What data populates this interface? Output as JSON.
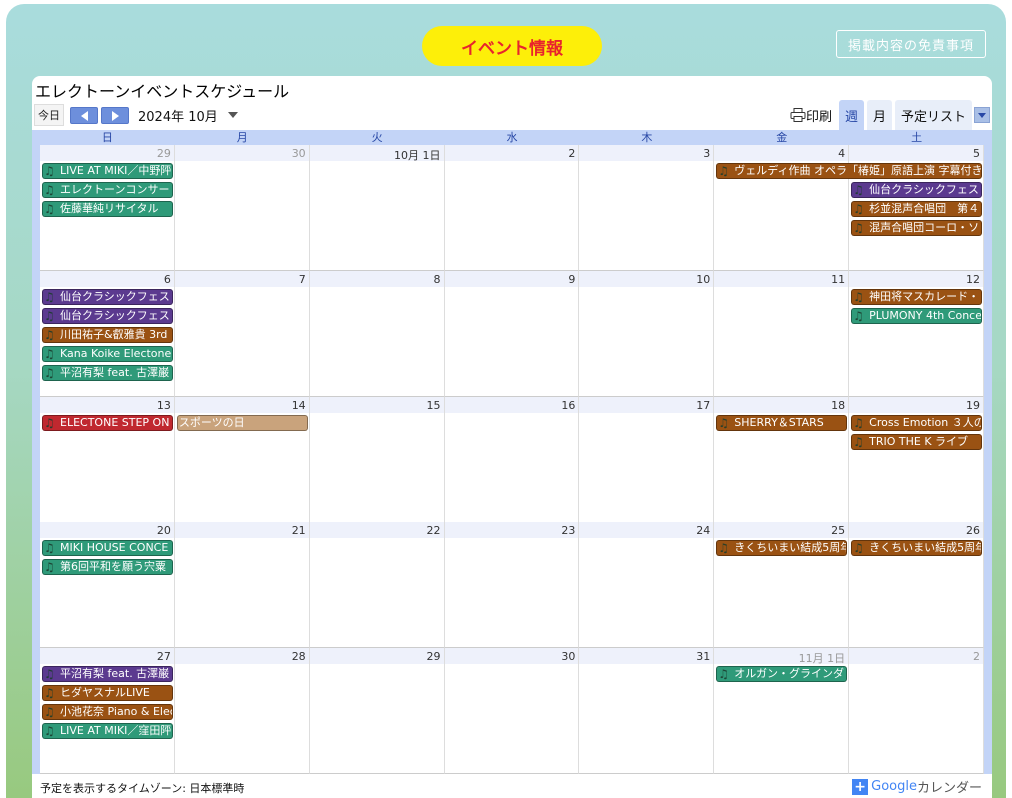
{
  "header": {
    "title": "イベント情報",
    "disclaimer_label": "掲載内容の免責事項"
  },
  "calendar": {
    "title": "エレクトーンイベントスケジュール",
    "today_label": "今日",
    "month_label": "2024年 10月",
    "print_label": "印刷",
    "tabs": [
      "週",
      "月",
      "予定リスト"
    ],
    "active_tab": "週",
    "weekdays": [
      "日",
      "月",
      "火",
      "水",
      "木",
      "金",
      "土"
    ],
    "weeks": [
      {
        "days": [
          "29",
          "30",
          "10月 1日",
          "2",
          "3",
          "4",
          "5"
        ],
        "other": [
          true,
          true,
          false,
          false,
          false,
          false,
          false
        ]
      },
      {
        "days": [
          "6",
          "7",
          "8",
          "9",
          "10",
          "11",
          "12"
        ],
        "other": [
          false,
          false,
          false,
          false,
          false,
          false,
          false
        ]
      },
      {
        "days": [
          "13",
          "14",
          "15",
          "16",
          "17",
          "18",
          "19"
        ],
        "other": [
          false,
          false,
          false,
          false,
          false,
          false,
          false
        ]
      },
      {
        "days": [
          "20",
          "21",
          "22",
          "23",
          "24",
          "25",
          "26"
        ],
        "other": [
          false,
          false,
          false,
          false,
          false,
          false,
          false
        ]
      },
      {
        "days": [
          "27",
          "28",
          "29",
          "30",
          "31",
          "11月 1日",
          "2"
        ],
        "other": [
          false,
          false,
          false,
          false,
          false,
          true,
          true
        ]
      }
    ],
    "events": [
      {
        "week": 0,
        "col": 0,
        "slot": 0,
        "text": "LIVE AT MIKI／中野𨸶",
        "color": "#2f9a79",
        "note": true
      },
      {
        "week": 0,
        "col": 0,
        "slot": 1,
        "text": "エレクトーンコンサー",
        "color": "#2f9a79",
        "note": true
      },
      {
        "week": 0,
        "col": 0,
        "slot": 2,
        "text": "佐藤華純リサイタル",
        "color": "#2f9a79",
        "note": true
      },
      {
        "week": 0,
        "col": 5,
        "slot": 0,
        "span": 2,
        "text": "ヴェルディ作曲 オペラ「椿姫」原語上演 字幕付き",
        "color": "#9a5213",
        "note": true
      },
      {
        "week": 0,
        "col": 6,
        "slot": 1,
        "text": "仙台クラシックフェス",
        "color": "#5b3a8f",
        "note": true
      },
      {
        "week": 0,
        "col": 6,
        "slot": 2,
        "text": "杉並混声合唱団　第４",
        "color": "#9a5213",
        "note": true
      },
      {
        "week": 0,
        "col": 6,
        "slot": 3,
        "text": "混声合唱団コーロ・ソ",
        "color": "#9a5213",
        "note": true
      },
      {
        "week": 1,
        "col": 0,
        "slot": 0,
        "text": "仙台クラシックフェス",
        "color": "#5b3a8f",
        "note": true
      },
      {
        "week": 1,
        "col": 0,
        "slot": 1,
        "text": "仙台クラシックフェス",
        "color": "#5b3a8f",
        "note": true
      },
      {
        "week": 1,
        "col": 0,
        "slot": 2,
        "text": "川田祐子&叡雅貴 3rd",
        "color": "#9a5213",
        "note": true
      },
      {
        "week": 1,
        "col": 0,
        "slot": 3,
        "text": "Kana Koike Electone",
        "color": "#2f9a79",
        "note": true
      },
      {
        "week": 1,
        "col": 0,
        "slot": 4,
        "text": "平沼有梨 feat. 古澤巌",
        "color": "#2f9a79",
        "note": true
      },
      {
        "week": 1,
        "col": 6,
        "slot": 0,
        "text": "神田将マスカレード・",
        "color": "#9a5213",
        "note": true
      },
      {
        "week": 1,
        "col": 6,
        "slot": 1,
        "text": "PLUMONY 4th Conce",
        "color": "#2f9a79",
        "note": true
      },
      {
        "week": 2,
        "col": 0,
        "slot": 0,
        "text": "ELECTONE STEP ON",
        "color": "#c0282f",
        "note": true
      },
      {
        "week": 2,
        "col": 1,
        "slot": 0,
        "text": "スポーツの日",
        "color": "#c9a37c",
        "note": false
      },
      {
        "week": 2,
        "col": 5,
        "slot": 0,
        "text": "SHERRY＆STARS",
        "color": "#9a5213",
        "note": true
      },
      {
        "week": 2,
        "col": 6,
        "slot": 0,
        "text": "Cross Emotion ３人の",
        "color": "#9a5213",
        "note": true
      },
      {
        "week": 2,
        "col": 6,
        "slot": 1,
        "text": "TRIO THE K ライブ",
        "color": "#9a5213",
        "note": true
      },
      {
        "week": 3,
        "col": 0,
        "slot": 0,
        "text": "MIKI HOUSE CONCE",
        "color": "#2f9a79",
        "note": true
      },
      {
        "week": 3,
        "col": 0,
        "slot": 1,
        "text": "第6回平和を願う宍粟",
        "color": "#2f9a79",
        "note": true
      },
      {
        "week": 3,
        "col": 5,
        "slot": 0,
        "text": "きくちいまい結成5周年",
        "color": "#9a5213",
        "note": true
      },
      {
        "week": 3,
        "col": 6,
        "slot": 0,
        "text": "きくちいまい結成5周年",
        "color": "#9a5213",
        "note": true
      },
      {
        "week": 4,
        "col": 0,
        "slot": 0,
        "text": "平沼有梨 feat. 古澤巌",
        "color": "#5b3a8f",
        "note": true
      },
      {
        "week": 4,
        "col": 0,
        "slot": 1,
        "text": "ヒダヤスナルLIVE",
        "color": "#9a5213",
        "note": true
      },
      {
        "week": 4,
        "col": 0,
        "slot": 2,
        "text": "小池花奈 Piano & Elec",
        "color": "#9a5213",
        "note": true
      },
      {
        "week": 4,
        "col": 0,
        "slot": 3,
        "text": "LIVE AT MIKI／窪田𨸶",
        "color": "#2f9a79",
        "note": true
      },
      {
        "week": 4,
        "col": 5,
        "slot": 0,
        "text": "オルガン・グラインダ",
        "color": "#2f9a79",
        "note": true
      }
    ],
    "timezone_label": "予定を表示するタイムゾーン: 日本標準時",
    "google_label": "Google",
    "calendar_word": "カレンダー"
  },
  "colors": {
    "accent": "#2848a6",
    "header_band": "#c3d4f7",
    "pill": "#fdef09",
    "pill_text": "#e8242d"
  }
}
